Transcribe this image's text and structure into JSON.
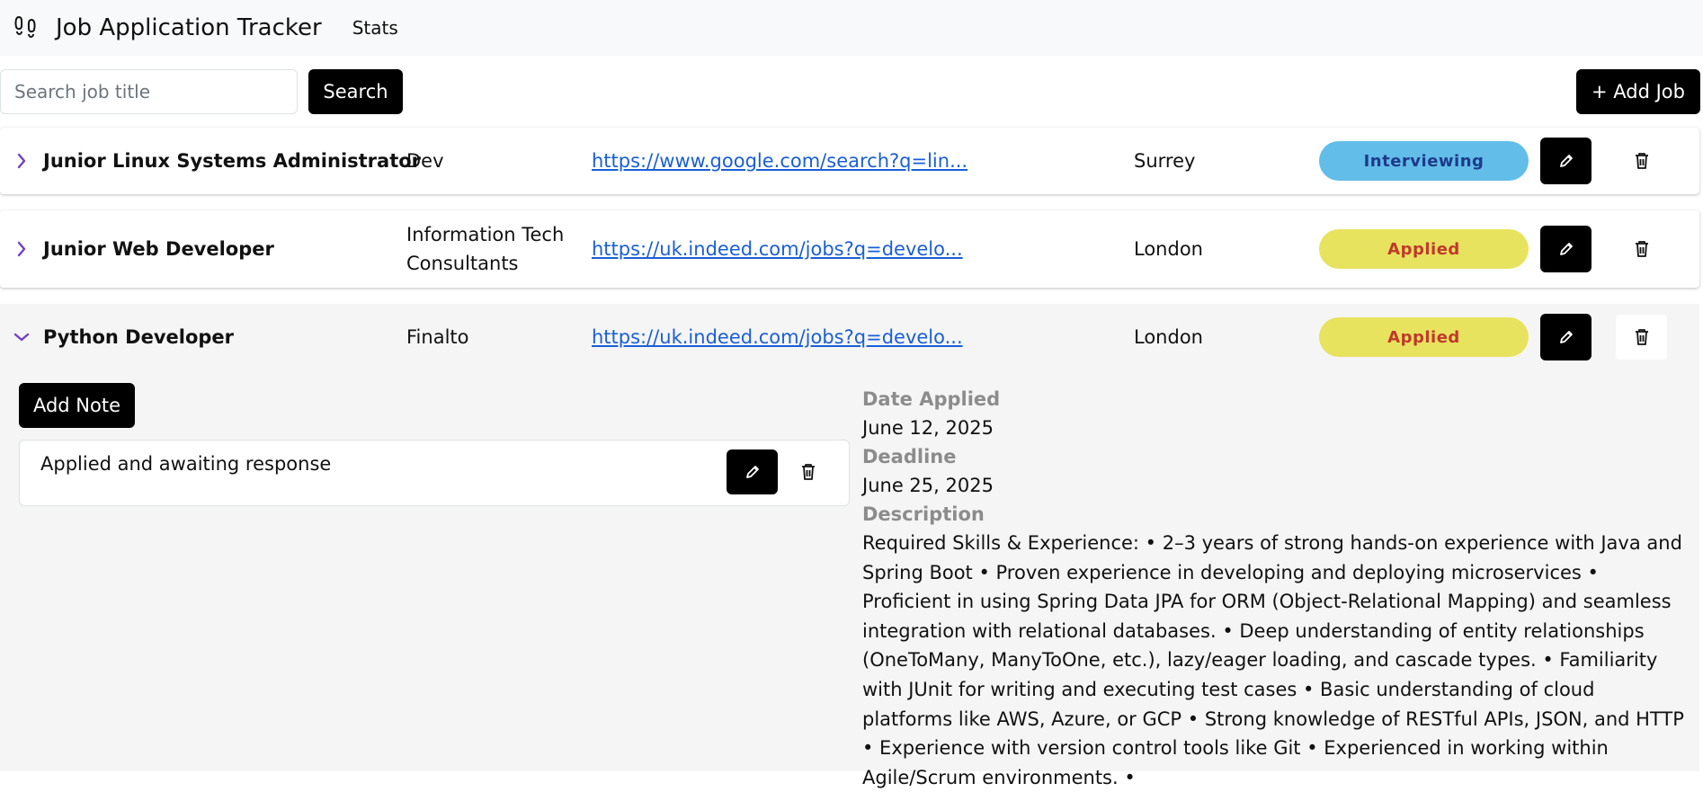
{
  "header": {
    "title": "Job Application Tracker",
    "nav_stats": "Stats",
    "logo_icon": "footprints-icon"
  },
  "search": {
    "placeholder": "Search job title",
    "value": "",
    "button_label": "Search"
  },
  "add_job_label": "+ Add Job",
  "jobs": [
    {
      "title": "Junior Linux Systems Administrator",
      "company": "Dev",
      "link": "https://www.google.com/search?q=lin...",
      "location": "Surrey",
      "status": "Interviewing",
      "expanded": false
    },
    {
      "title": "Junior Web Developer",
      "company": "Information Tech Consultants",
      "link": "https://uk.indeed.com/jobs?q=develo...",
      "location": "London",
      "status": "Applied",
      "expanded": false
    },
    {
      "title": "Python Developer",
      "company": "Finalto",
      "link": "https://uk.indeed.com/jobs?q=develo...",
      "location": "London",
      "status": "Applied",
      "expanded": true
    }
  ],
  "expanded_job": {
    "add_note_label": "Add Note",
    "notes": [
      {
        "text": "Applied and awaiting response"
      }
    ],
    "date_applied_label": "Date Applied",
    "date_applied": "June 12, 2025",
    "deadline_label": "Deadline",
    "deadline": "June 25, 2025",
    "description_label": "Description",
    "description": "Required Skills & Experience: • 2–3 years of strong hands-on experience with Java and Spring Boot • Proven experience in developing and deploying microservices • Proficient in using Spring Data JPA for ORM (Object-Relational Mapping) and seamless integration with relational databases. • Deep understanding of entity relationships (OneToMany, ManyToOne, etc.), lazy/eager loading, and cascade types. • Familiarity with JUnit for writing and executing test cases • Basic understanding of cloud platforms like AWS, Azure, or GCP • Strong knowledge of RESTful APIs, JSON, and HTTP • Experience with version control tools like Git • Experienced in working within Agile/Scrum environments. •"
  },
  "colors": {
    "status_interviewing_bg": "#62bde8",
    "status_interviewing_text": "#1e3a8a",
    "status_applied_bg": "#e8e35f",
    "status_applied_text": "#c0392b",
    "chevron": "#6f42c1",
    "link": "#1a5fd6"
  }
}
